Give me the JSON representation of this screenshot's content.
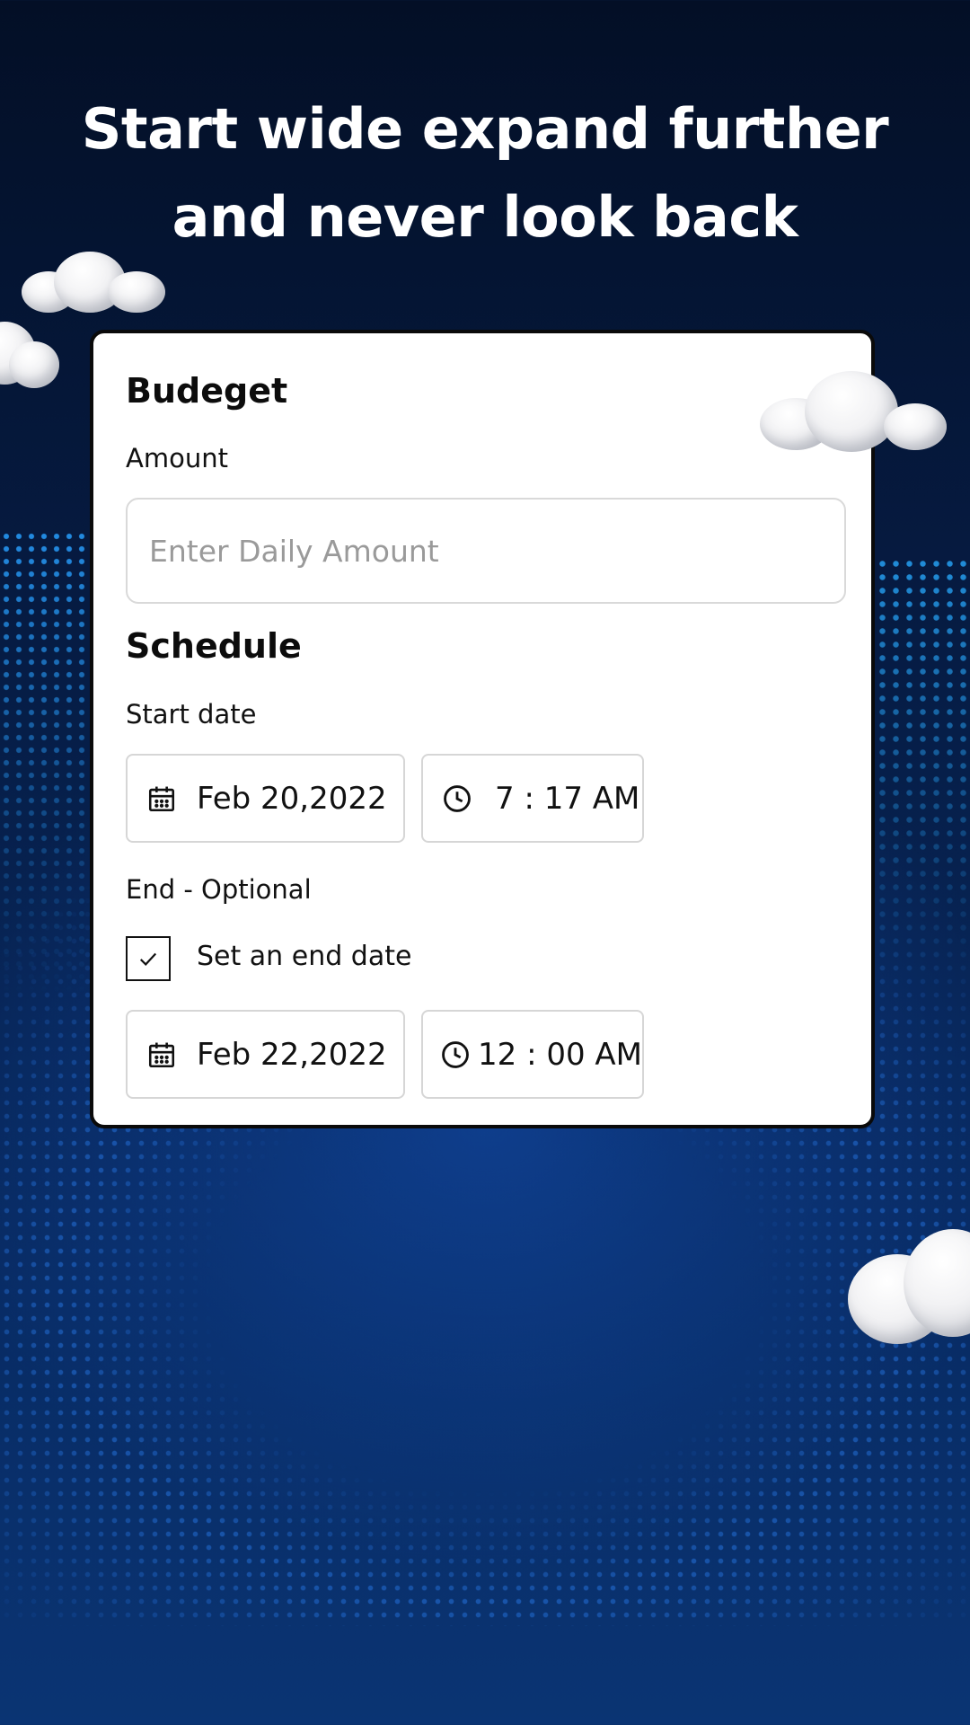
{
  "headline": {
    "line1": "Start wide expand further",
    "line2": "and never look back"
  },
  "budget": {
    "title": "Budeget",
    "amount_label": "Amount",
    "amount_value": "",
    "amount_placeholder": "Enter Daily Amount"
  },
  "schedule": {
    "title": "Schedule",
    "start_label": "Start date",
    "start_date": "Feb 20,2022",
    "start_time": "7 : 17 AM",
    "end_label": "End - Optional",
    "end_checkbox_label": "Set an end date",
    "end_checkbox_checked": true,
    "end_date": "Feb 22,2022",
    "end_time": "12 : 00 AM"
  },
  "icons": {
    "date": "calendar-icon",
    "time": "clock-icon",
    "check": "checkmark-icon"
  },
  "colors": {
    "background_top": "#030f26",
    "background_bottom": "#0a3473",
    "card": "#ffffff",
    "card_border": "#0a0a0a",
    "placeholder": "#9a9a9a"
  }
}
